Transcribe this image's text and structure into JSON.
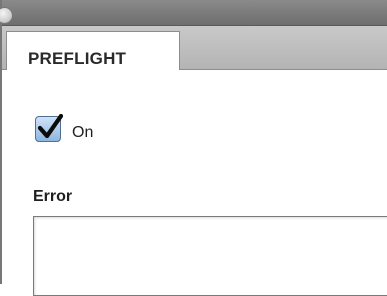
{
  "panel": {
    "tabs": [
      {
        "label": "PREFLIGHT",
        "active": true
      }
    ]
  },
  "controls": {
    "on_checkbox": {
      "checked": true,
      "label": "On"
    },
    "error": {
      "label": "Error",
      "value": ""
    }
  },
  "colors": {
    "checkbox_fill": "#8fb6e0",
    "checkmark": "#0b0b0b"
  },
  "icons": {
    "close": "close-icon",
    "checkmark": "checkmark-icon"
  }
}
